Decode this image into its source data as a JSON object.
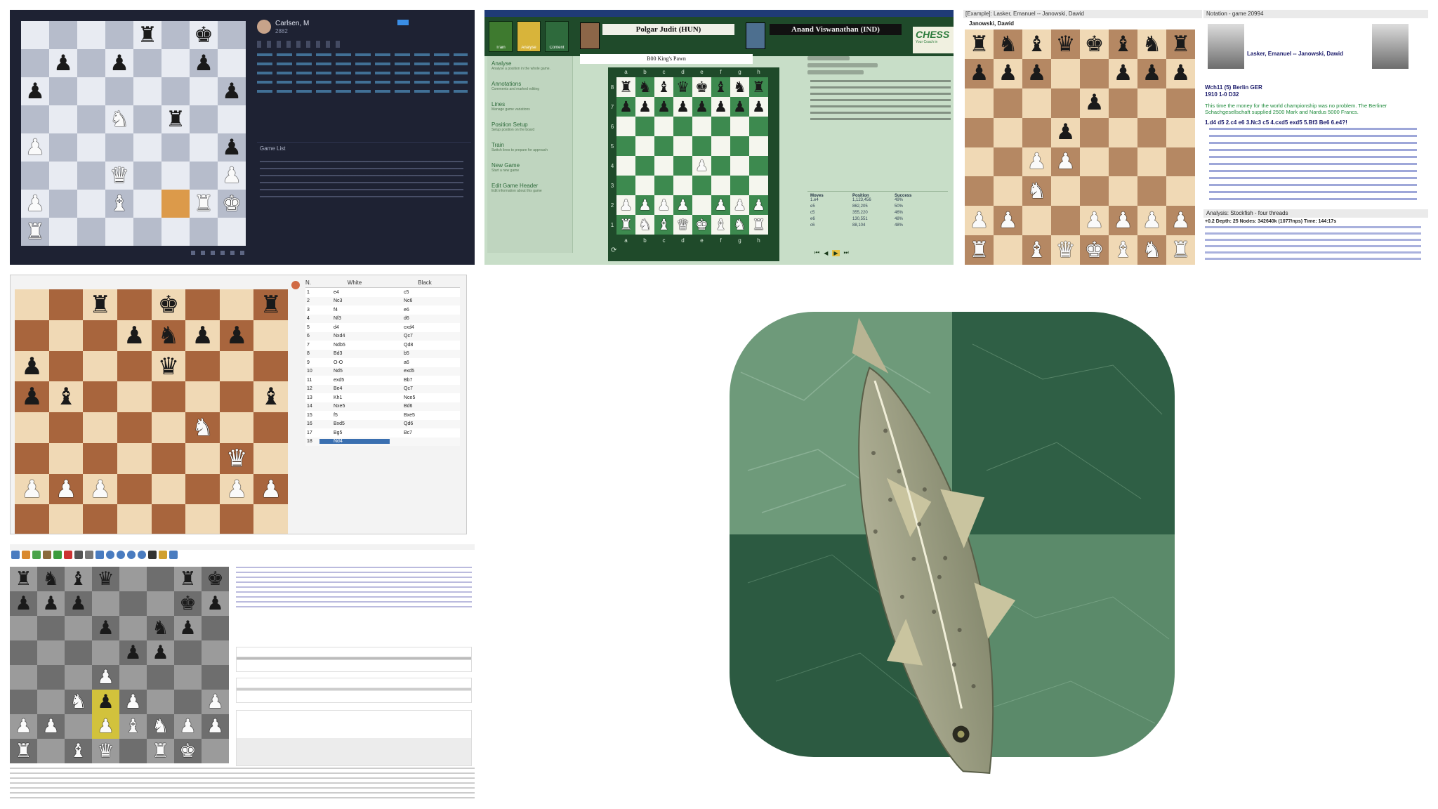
{
  "panel1": {
    "player_name": "Carlsen, M",
    "player_sub": "2882",
    "games_list_title": "Game List",
    "board": [
      "....r.k.",
      ".p.p..p.",
      "p......p",
      "...N.r..",
      "P......p",
      "...Q...P",
      "P..B..RK",
      "R.......",
      ""
    ],
    "highlight": "f2",
    "colors": {
      "light": "#e8ebf2",
      "dark": "#b6bccb",
      "bg": "#1e2233",
      "hl": "#dc9a4a"
    }
  },
  "panel2": {
    "player_white": "Polgar Judit (HUN)",
    "player_black": "Anand Viswanathan (IND)",
    "opening": "B00 King's Pawn",
    "logo": "CHESS",
    "logo_sub": "Your Coach in",
    "menu": [
      {
        "title": "Analyse",
        "desc": "Analyse a position in the whole game."
      },
      {
        "title": "Annotations",
        "desc": "Comments and marked editing"
      },
      {
        "title": "Lines",
        "desc": "Manage game variations"
      },
      {
        "title": "Position Setup",
        "desc": "Setup position on the board"
      },
      {
        "title": "Train",
        "desc": "Switch lines to prepare for approach"
      },
      {
        "title": "New Game",
        "desc": "Start a new game"
      },
      {
        "title": "Edit Game Header",
        "desc": "Edit information about this game"
      }
    ],
    "toolbar": [
      "Train",
      "Analyse",
      "Content"
    ],
    "files": [
      "a",
      "b",
      "c",
      "d",
      "e",
      "f",
      "g",
      "h"
    ],
    "ranks": [
      "8",
      "7",
      "6",
      "5",
      "4",
      "3",
      "2",
      "1"
    ],
    "stats_headers": [
      "Moves",
      "Position",
      "Success"
    ],
    "stats_rows": [
      [
        "1.e4",
        "1,123,456",
        "49%"
      ],
      [
        "e5",
        "862,205",
        "50%"
      ],
      [
        "c5",
        "355,220",
        "46%"
      ],
      [
        "e6",
        "130,551",
        "48%"
      ],
      [
        "c6",
        "88,104",
        "48%"
      ]
    ],
    "board": [
      "rnbqkbnr",
      "pppppppp",
      "........",
      "........",
      "....P...",
      "........",
      "PPPP.PPP",
      "RNBQKBNR"
    ],
    "colors": {
      "light": "#f5f6ee",
      "dark": "#3d8a4f",
      "bg": "#c8dec8",
      "header": "#1f4a2a"
    }
  },
  "panel3": {
    "tab_title": "[Example]: Lasker, Emanuel -- Janowski, Dawid",
    "notation_tab": "Notation - game 20994",
    "player_top": "Janowski, Dawid",
    "name_white": "Lasker, Emanuel",
    "name_sep": "--",
    "name_black": "Janowski, Dawid",
    "event": "Wch11 (5)  Berlin GER",
    "result_line": "1910  1-0  D32",
    "comment": "This time the money for the world championship was no problem. The Berliner Schachgesellschaft supplied 2500 Mark and Nardus 5000 Francs.",
    "moves": "1.d4 d5 2.c4 e6 3.Nc3 c5 4.cxd5 exd5 5.Bf3 Be6 6.e4?!",
    "analysis_title": "Analysis: Stockfish - four threads",
    "analysis_line": "+0.2 Depth: 25  Nodes: 342640k (1077/nps)  Time: 144:17s",
    "board": [
      "rnbqkbnr",
      "ppp..ppp",
      "....p...",
      "...p....",
      "..PP....",
      "..N.....",
      "PP..PPPP",
      "R.BQKBNR"
    ],
    "colors": {
      "light": "#f0d9b5",
      "dark": "#b58863"
    }
  },
  "panel4": {
    "col_n": "N.",
    "col_white": "White",
    "col_black": "Black",
    "moves": [
      [
        "1",
        "e4",
        "c5"
      ],
      [
        "2",
        "Nc3",
        "Nc6"
      ],
      [
        "3",
        "f4",
        "e6"
      ],
      [
        "4",
        "Nf3",
        "d6"
      ],
      [
        "5",
        "d4",
        "cxd4"
      ],
      [
        "6",
        "Nxd4",
        "Qc7"
      ],
      [
        "7",
        "Ndb5",
        "Qd8"
      ],
      [
        "8",
        "Bd3",
        "b5"
      ],
      [
        "9",
        "O-O",
        "a6"
      ],
      [
        "10",
        "Nd5",
        "exd5"
      ],
      [
        "11",
        "exd5",
        "Bb7"
      ],
      [
        "12",
        "Be4",
        "Qc7"
      ],
      [
        "13",
        "Kh1",
        "Nce5"
      ],
      [
        "14",
        "Nxe5",
        "Bd6"
      ],
      [
        "15",
        "f5",
        "Bxe5"
      ],
      [
        "16",
        "Bxd5",
        "Qd6"
      ],
      [
        "17",
        "Bg5",
        "Bc7"
      ],
      [
        "18",
        "Nd4",
        ""
      ]
    ],
    "selected_row": 17,
    "board": [
      "..r.k..r",
      "...pnpp.",
      "p...q...",
      "pb.....bp",
      ".....N..",
      "......Q.",
      "PPP...PP",
      "........"
    ],
    "colors": {
      "light": "#f0d9b5",
      "dark": "#a8653d"
    }
  },
  "panel5": {
    "board": [
      "rnbq..rk",
      "ppp...kp",
      "...p.np.",
      "....pp..",
      "...P....",
      "..NpP..P",
      "PP.PBNPP",
      "R.BQ.RK."
    ],
    "highlight": [
      "d2",
      "d3"
    ],
    "colors": {
      "light": "#9b9b9b",
      "dark": "#6e6e6e",
      "hl": "#d2c23c"
    }
  },
  "panel6": {
    "icon": "stockfish-app-icon",
    "colors": {
      "tile_light": "#5e8c6d",
      "tile_dark": "#2c5a41",
      "fish": "#9ca083"
    }
  }
}
